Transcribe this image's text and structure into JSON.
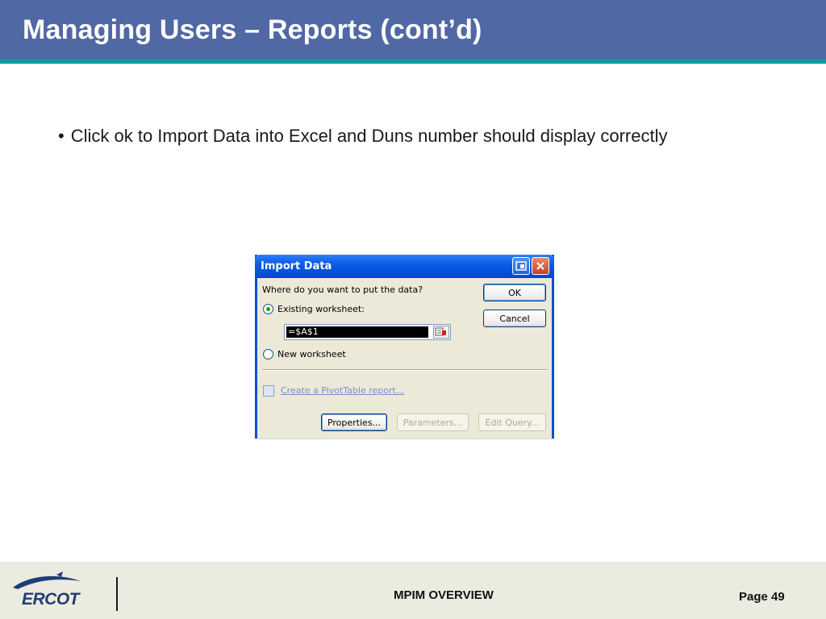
{
  "slide": {
    "title": "Managing Users – Reports (cont’d)",
    "bullet": "Click ok to Import Data into Excel and Duns number should display correctly"
  },
  "dialog": {
    "title": "Import Data",
    "question": "Where do you want to put the data?",
    "existing_worksheet_label": "Existing worksheet:",
    "existing_worksheet_selected": true,
    "cell_reference": "=$A$1",
    "new_worksheet_label": "New worksheet",
    "new_worksheet_selected": false,
    "pivot_link": "Create a PivotTable report...",
    "ok_label": "OK",
    "cancel_label": "Cancel",
    "properties_label": "Properties...",
    "parameters_label": "Parameters...",
    "edit_query_label": "Edit Query..."
  },
  "footer": {
    "logo_text": "ERCOT",
    "center_text": "MPIM OVERVIEW",
    "page_label": "Page 49"
  },
  "colors": {
    "title_bar": "#5068a4",
    "title_rule": "#119aa0",
    "footer_bg": "#ecebe0"
  }
}
